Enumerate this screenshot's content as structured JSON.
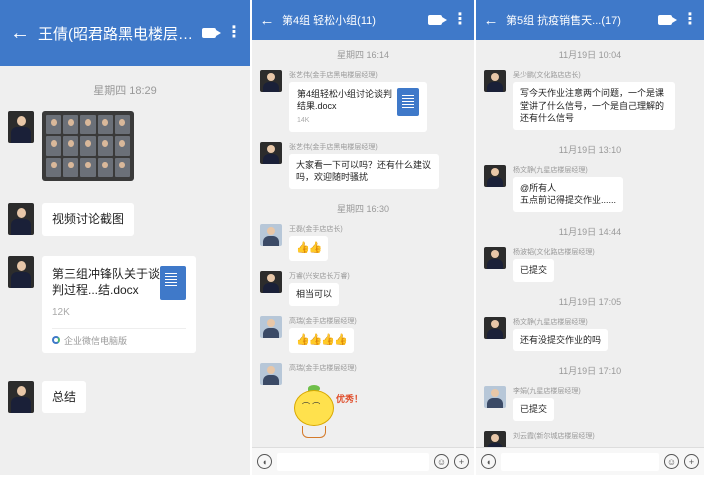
{
  "panel1": {
    "title": "王倩(昭君路黑电楼层经理)",
    "time": "星期四  18:29",
    "messages": {
      "video_label": "视频讨论截图",
      "file_name": "第三组冲锋队关于谈判过程...结.docx",
      "file_size": "12K",
      "file_source": "企业微信电脑版",
      "summary": "总结"
    }
  },
  "panel2": {
    "title": "第4组  轻松小组(11)",
    "times": [
      "星期四  16:14",
      "星期四  16:30"
    ],
    "messages": [
      {
        "sender": "张艺伟(金手店黑电楼层经理)",
        "file_name": "第4组轻松小组讨论谈判结果.docx",
        "file_size": "14K"
      },
      {
        "sender": "张艺伟(金手店黑电楼层经理)",
        "text": "大家看一下可以吗？还有什么建议吗，欢迎随时骚扰"
      },
      {
        "sender": "王磊(金手店店长)",
        "text": "👍👍"
      },
      {
        "sender": "万睿(兴安店长万睿)",
        "text": "相当可以"
      },
      {
        "sender": "高瑞(金手店楼层经理)",
        "text": "👍👍👍👍"
      },
      {
        "sender": "高瑞(金手店楼层经理)",
        "sticker_text": "优秀！"
      }
    ]
  },
  "panel3": {
    "title": "第5组  抗疫销售天...(17)",
    "times": [
      "11月19日  10:04",
      "11月19日  13:10",
      "11月19日  14:44",
      "11月19日  17:05",
      "11月19日  17:10"
    ],
    "messages": [
      {
        "sender": "吴少鹏(文化路店店长)",
        "text": "写今天作业注意两个问题，一个是课堂讲了什么信号，一个是自己理解的还有什么信号"
      },
      {
        "sender": "杨文静(九星店楼层经理)",
        "text": "@所有人\n五点前记得提交作业......"
      },
      {
        "sender": "杨波韬(文化路店楼层经理)",
        "text": "已提交"
      },
      {
        "sender": "杨文静(九星店楼层经理)",
        "text": "还有没提交作业的吗"
      },
      {
        "sender": "李娟(九星店楼层经理)",
        "text": "已提交"
      },
      {
        "sender": "刘云霞(新尔城店楼层经理)"
      }
    ]
  }
}
